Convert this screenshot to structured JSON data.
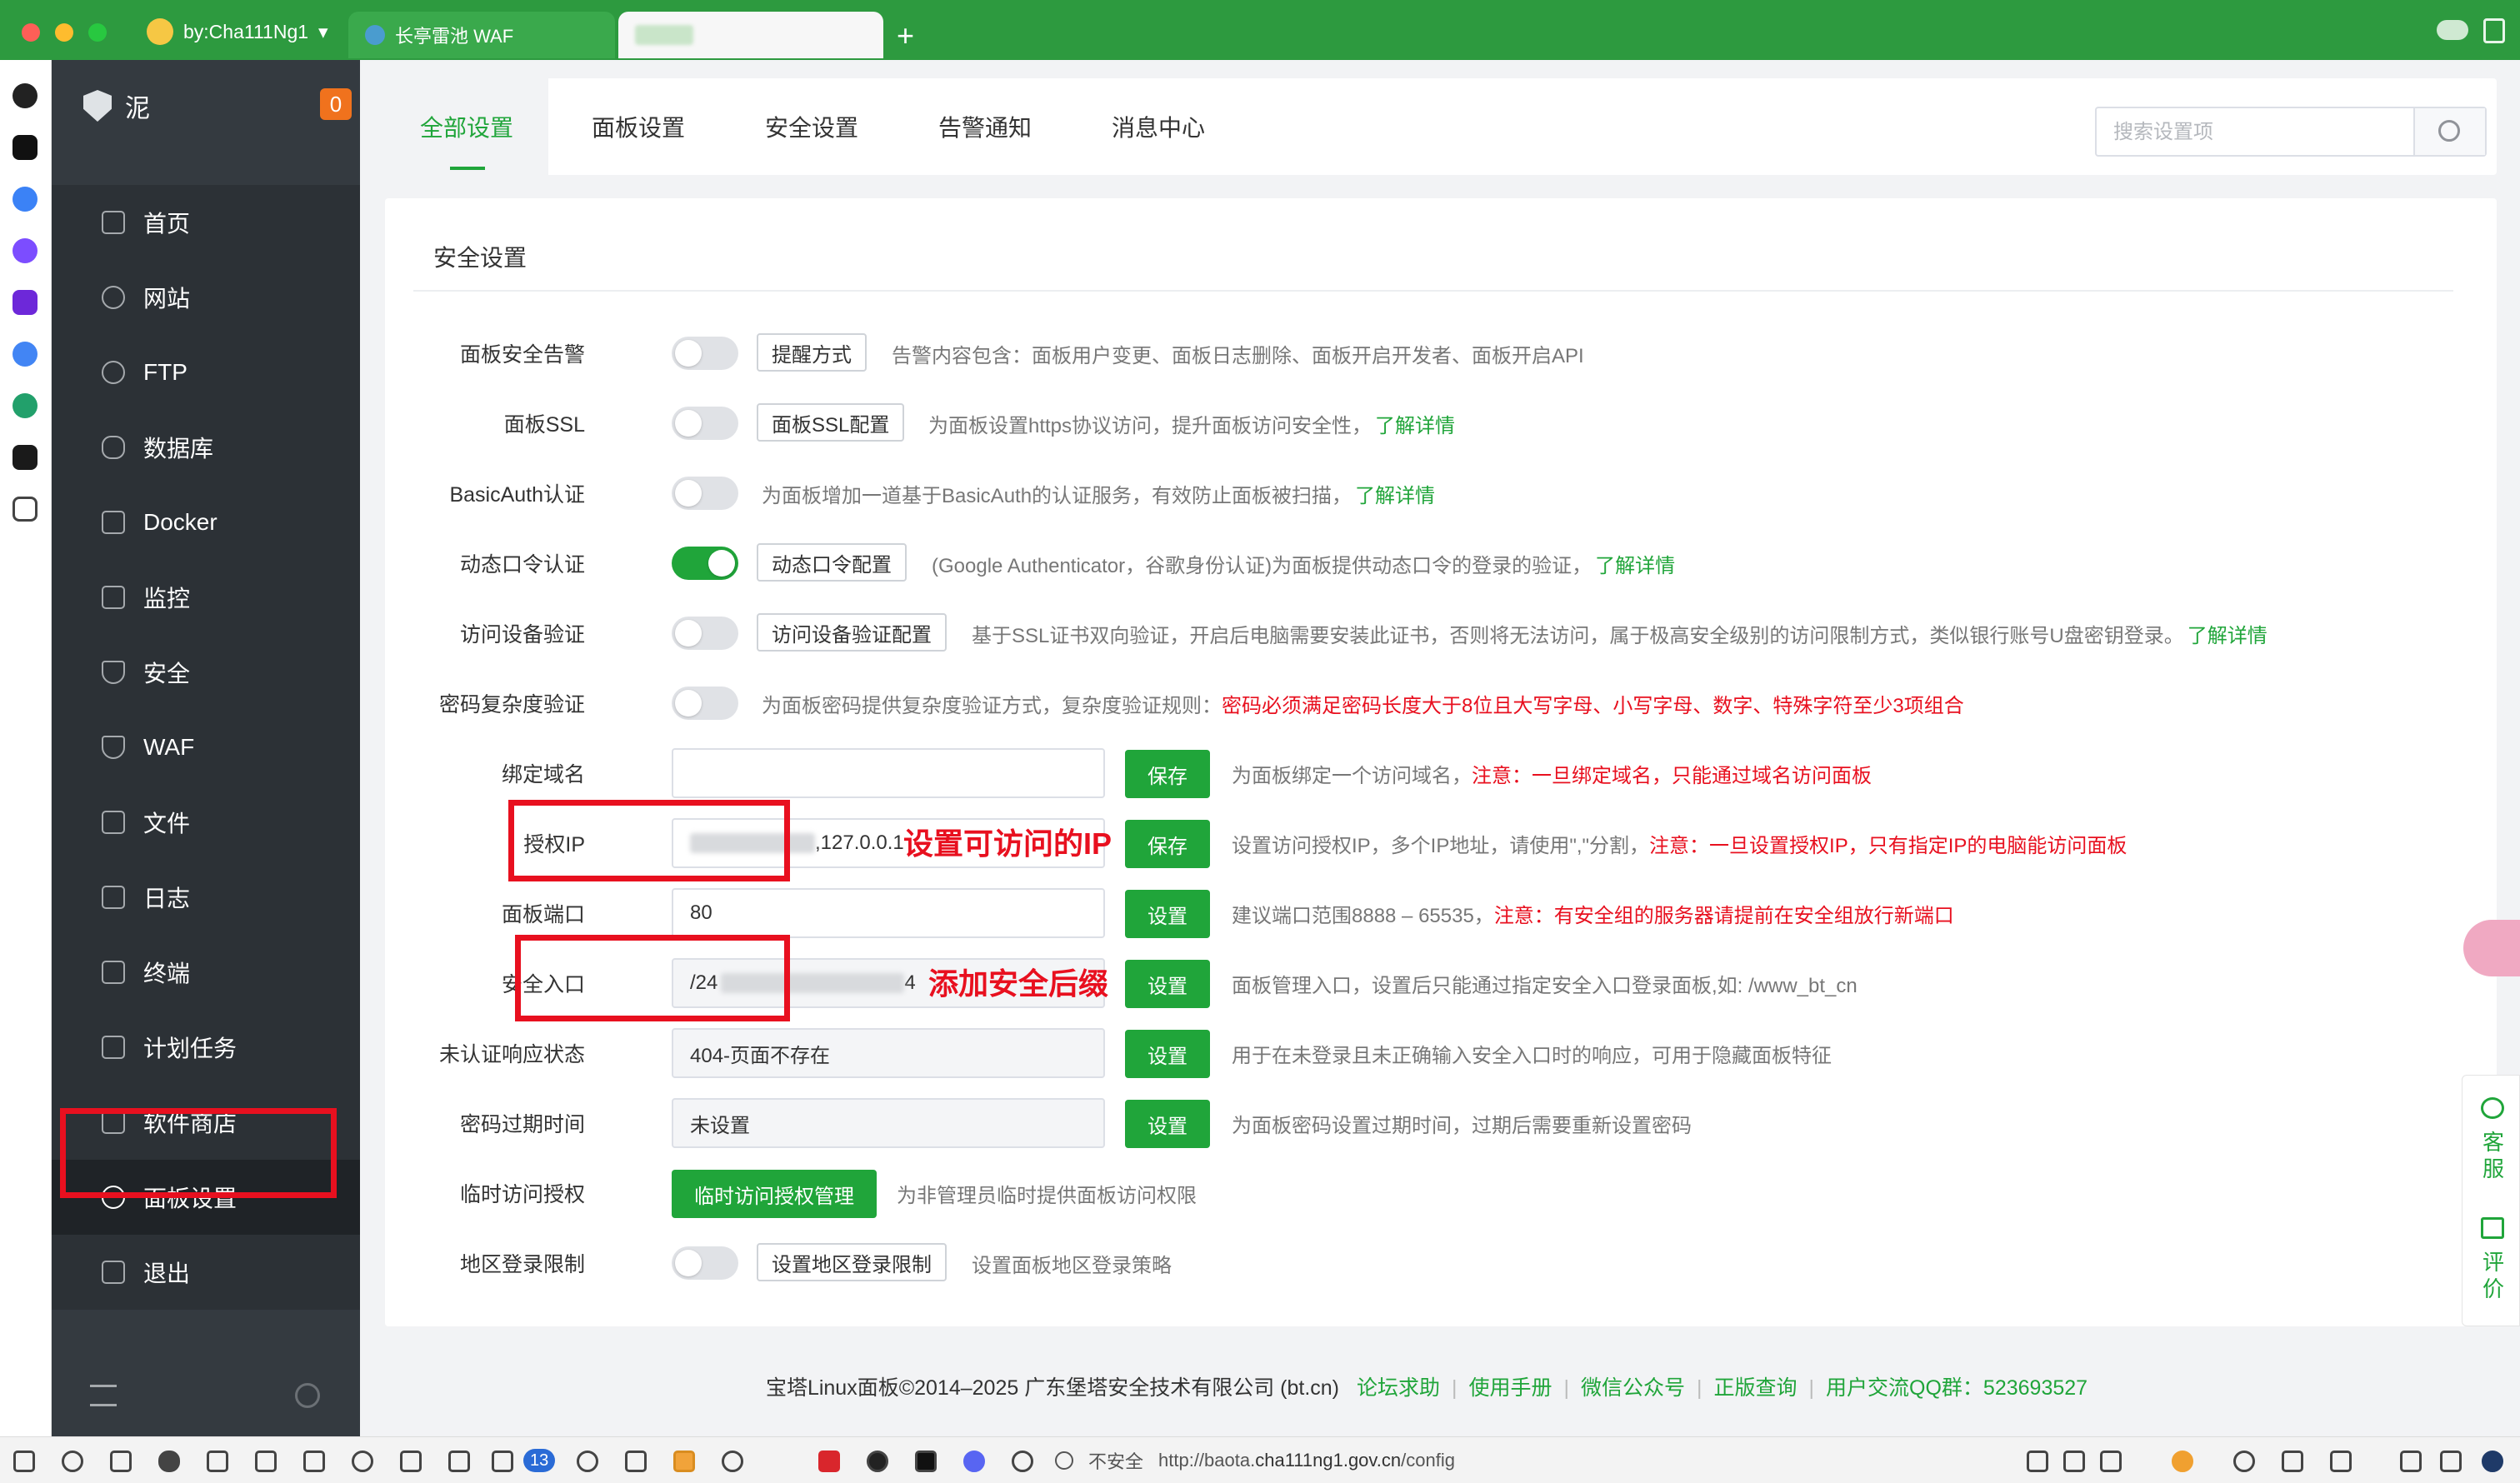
{
  "browser": {
    "profile_label": "by:Cha111Ng1",
    "tabs": [
      {
        "title": "长亭雷池 WAF"
      },
      {
        "title": ""
      }
    ],
    "new_tab": "+"
  },
  "sidebar": {
    "brand": "泥",
    "badge": "0",
    "items": [
      {
        "label": "首页",
        "icon": "home-icon"
      },
      {
        "label": "网站",
        "icon": "globe-icon"
      },
      {
        "label": "FTP",
        "icon": "globe-icon"
      },
      {
        "label": "数据库",
        "icon": "database-icon"
      },
      {
        "label": "Docker",
        "icon": "docker-icon"
      },
      {
        "label": "监控",
        "icon": "monitor-icon"
      },
      {
        "label": "安全",
        "icon": "shield-icon"
      },
      {
        "label": "WAF",
        "icon": "shield-icon"
      },
      {
        "label": "文件",
        "icon": "folder-icon"
      },
      {
        "label": "日志",
        "icon": "log-icon"
      },
      {
        "label": "终端",
        "icon": "terminal-icon"
      },
      {
        "label": "计划任务",
        "icon": "calendar-icon"
      },
      {
        "label": "软件商店",
        "icon": "apps-icon"
      },
      {
        "label": "面板设置",
        "icon": "gear-icon",
        "active": true
      },
      {
        "label": "退出",
        "icon": "logout-icon"
      }
    ]
  },
  "settings_tabs": [
    "全部设置",
    "面板设置",
    "安全设置",
    "告警通知",
    "消息中心"
  ],
  "search": {
    "placeholder": "搜索设置项"
  },
  "section_title": "安全设置",
  "rows": {
    "alert": {
      "label": "面板安全告警",
      "button": "提醒方式",
      "desc": "告警内容包含：面板用户变更、面板日志删除、面板开启开发者、面板开启API"
    },
    "ssl": {
      "label": "面板SSL",
      "button": "面板SSL配置",
      "desc": "为面板设置https协议访问，提升面板访问安全性，",
      "link": "了解详情"
    },
    "basicauth": {
      "label": "BasicAuth认证",
      "desc": "为面板增加一道基于BasicAuth的认证服务，有效防止面板被扫描，",
      "link": "了解详情"
    },
    "otp": {
      "label": "动态口令认证",
      "button": "动态口令配置",
      "desc": "(Google Authenticator，谷歌身份认证)为面板提供动态口令的登录的验证，",
      "link": "了解详情"
    },
    "device": {
      "label": "访问设备验证",
      "button": "访问设备验证配置",
      "desc": "基于SSL证书双向验证，开启后电脑需要安装此证书，否则将无法访问，属于极高安全级别的访问限制方式，类似银行账号U盘密钥登录。",
      "link": "了解详情"
    },
    "pwd_complex": {
      "label": "密码复杂度验证",
      "desc": "为面板密码提供复杂度验证方式，复杂度验证规则：",
      "red": "密码必须满足密码长度大于8位且大写字母、小写字母、数字、特殊字符至少3项组合"
    },
    "domain": {
      "label": "绑定域名",
      "value": "",
      "button": "保存",
      "desc": "为面板绑定一个访问域名，",
      "red": "注意：一旦绑定域名，只能通过域名访问面板"
    },
    "auth_ip": {
      "label": "授权IP",
      "value": ",127.0.0.1",
      "button": "保存",
      "desc": "设置访问授权IP，多个IP地址，请使用\",\"分割，",
      "red": "注意：一旦设置授权IP，只有指定IP的电脑能访问面板",
      "annotation": "设置可访问的IP"
    },
    "port": {
      "label": "面板端口",
      "value": "80",
      "button": "设置",
      "desc": "建议端口范围8888 – 65535，",
      "red": "注意：有安全组的服务器请提前在安全组放行新端口"
    },
    "entry": {
      "label": "安全入口",
      "value_prefix": "/24",
      "value_suffix": "4",
      "button": "设置",
      "desc": "面板管理入口，设置后只能通过指定安全入口登录面板,如: /www_bt_cn",
      "annotation": "添加安全后缀"
    },
    "unauth": {
      "label": "未认证响应状态",
      "value": "404-页面不存在",
      "button": "设置",
      "desc": "用于在未登录且未正确输入安全入口时的响应，可用于隐藏面板特征"
    },
    "pwd_expire": {
      "label": "密码过期时间",
      "value": "未设置",
      "button": "设置",
      "desc": "为面板密码设置过期时间，过期后需要重新设置密码"
    },
    "temp_access": {
      "label": "临时访问授权",
      "button": "临时访问授权管理",
      "desc": "为非管理员临时提供面板访问权限"
    },
    "region": {
      "label": "地区登录限制",
      "button": "设置地区登录限制",
      "desc": "设置面板地区登录策略"
    }
  },
  "toggles": {
    "alert": false,
    "ssl": false,
    "basicauth": false,
    "otp": true,
    "device": false,
    "pwd_complex": false,
    "region": false
  },
  "footer": {
    "copyright": "宝塔Linux面板©2014–2025 广东堡塔安全技术有限公司 (bt.cn)",
    "links": [
      "论坛求助",
      "使用手册",
      "微信公众号",
      "正版查询",
      "用户交流QQ群：523693527"
    ]
  },
  "float": {
    "service": "客服",
    "review": "评价"
  },
  "statusbar": {
    "badge": "13",
    "security": "不安全",
    "url_prefix": "http://baota.",
    "url_host": "cha111ng1.gov.cn",
    "url_path": "/config"
  },
  "colors": {
    "accent": "#20a53a",
    "sidebar": "#343a40",
    "annotation": "#e8101f",
    "browser_bar": "#2d9a3f"
  }
}
